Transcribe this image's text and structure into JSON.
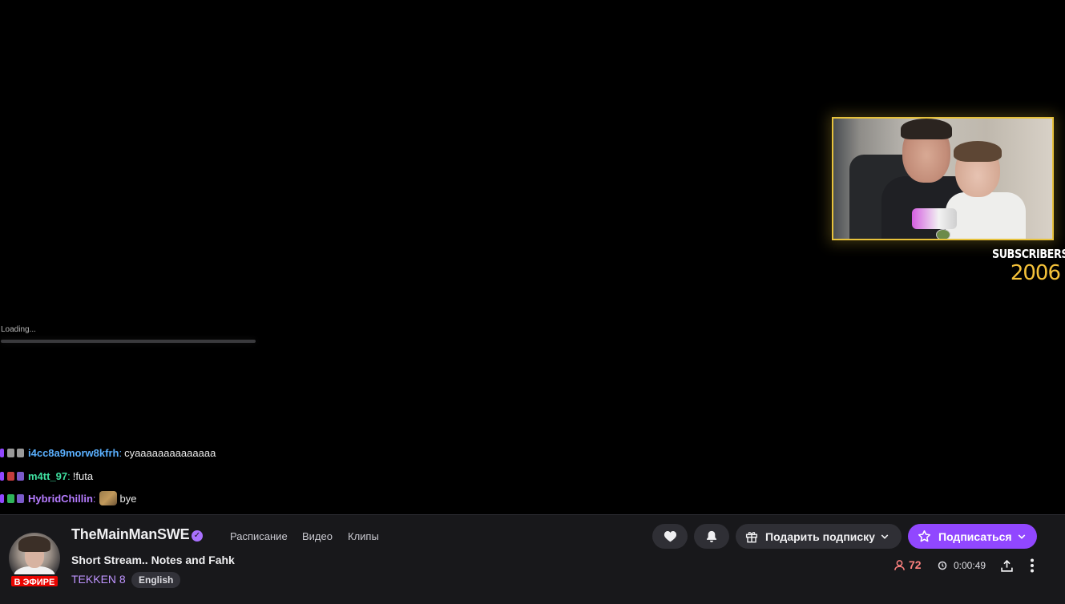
{
  "overlay": {
    "subscribers_label": "SUBSCRIBERS",
    "subscribers_count": "2006",
    "loading_text": "Loading..."
  },
  "chat": [
    {
      "user": "i4cc8a9morw8kfrh",
      "separator": ":",
      "message": "cyaaaaaaaaaaaaaa",
      "user_color": "#5ab0ff"
    },
    {
      "user": "m4tt_97",
      "separator": ":",
      "message": "!futa",
      "user_color": "#3fe0a0"
    },
    {
      "user": "HybridChillin",
      "separator": ":",
      "message": "bye",
      "user_color": "#b67cff"
    }
  ],
  "channel": {
    "name": "TheMainManSWE",
    "live_label": "В ЭФИРЕ",
    "nav": [
      "Расписание",
      "Видео",
      "Клипы"
    ],
    "stream_title": "Short Stream.. Notes and Fahk",
    "category": "TEKKEN 8",
    "tag": "English"
  },
  "actions": {
    "gift_label": "Подарить подписку",
    "subscribe_label": "Подписаться",
    "viewers": "72",
    "uptime": "0:00:49"
  },
  "colors": {
    "accent": "#9147ff",
    "live": "#eb0400",
    "viewers": "#ff8280",
    "subs_count": "#f5c23a",
    "cam_border": "#e7c23c"
  }
}
